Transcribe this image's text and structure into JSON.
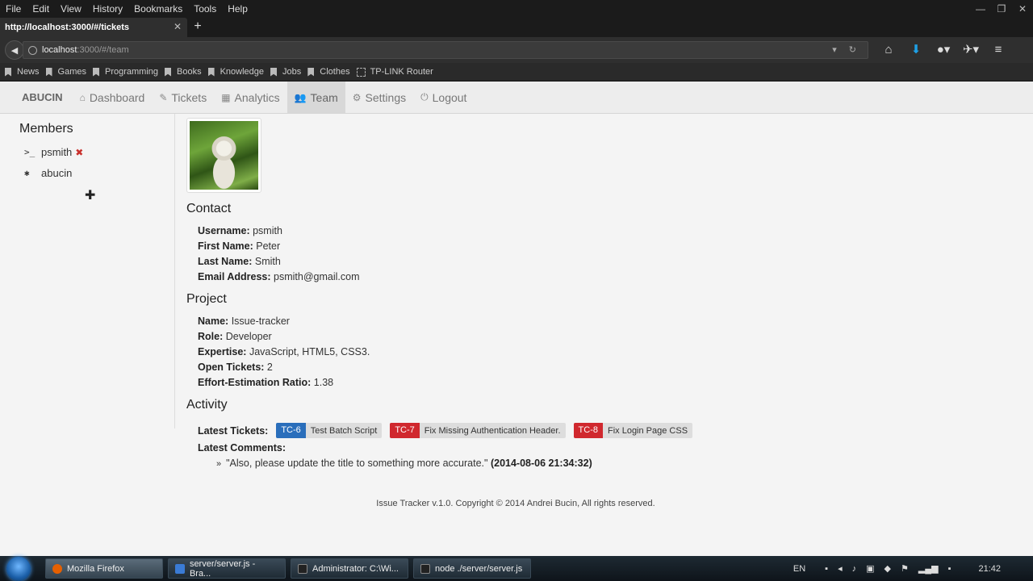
{
  "browser": {
    "menu": [
      "File",
      "Edit",
      "View",
      "History",
      "Bookmarks",
      "Tools",
      "Help"
    ],
    "window_controls": [
      "—",
      "❐",
      "✕"
    ],
    "tab_title": "http://localhost:3000/#/tickets",
    "new_tab": "+",
    "url_host": "localhost",
    "url_path": ":3000/#/team",
    "bookmarks": [
      "News",
      "Games",
      "Programming",
      "Books",
      "Knowledge",
      "Jobs",
      "Clothes",
      "TP-LINK Router"
    ]
  },
  "app": {
    "brand": "ABUCIN",
    "nav": [
      "Dashboard",
      "Tickets",
      "Analytics",
      "Team",
      "Settings",
      "Logout"
    ],
    "active_nav": "Team"
  },
  "sidebar": {
    "title": "Members",
    "members": [
      "psmith",
      "abucin"
    ],
    "add": "✚"
  },
  "contact": {
    "title": "Contact",
    "username_label": "Username:",
    "username": "psmith",
    "first_name_label": "First Name:",
    "first_name": "Peter",
    "last_name_label": "Last Name:",
    "last_name": "Smith",
    "email_label": "Email Address:",
    "email": "psmith@gmail.com"
  },
  "project": {
    "title": "Project",
    "name_label": "Name:",
    "name": "Issue-tracker",
    "role_label": "Role:",
    "role": "Developer",
    "expertise_label": "Expertise:",
    "expertise": "JavaScript, HTML5, CSS3.",
    "open_tickets_label": "Open Tickets:",
    "open_tickets": "2",
    "ratio_label": "Effort-Estimation Ratio:",
    "ratio": "1.38"
  },
  "activity": {
    "title": "Activity",
    "latest_tickets_label": "Latest Tickets:",
    "tickets": [
      {
        "id": "TC-6",
        "title": "Test Batch Script",
        "color": "#2a6ebb"
      },
      {
        "id": "TC-7",
        "title": "Fix Missing Authentication Header.",
        "color": "#d0282e"
      },
      {
        "id": "TC-8",
        "title": "Fix Login Page CSS",
        "color": "#d0282e"
      }
    ],
    "latest_comments_label": "Latest Comments:",
    "comment_text": "\"Also, please update the title to something more accurate.\"",
    "comment_time": "(2014-08-06 21:34:32)"
  },
  "footer": "Issue Tracker v.1.0. Copyright © 2014 Andrei Bucin, All rights reserved.",
  "taskbar": {
    "tasks": [
      "Mozilla Firefox",
      "server/server.js - Bra...",
      "Administrator: C:\\Wi...",
      "node ./server/server.js"
    ],
    "lang": "EN",
    "clock": "21:42"
  }
}
